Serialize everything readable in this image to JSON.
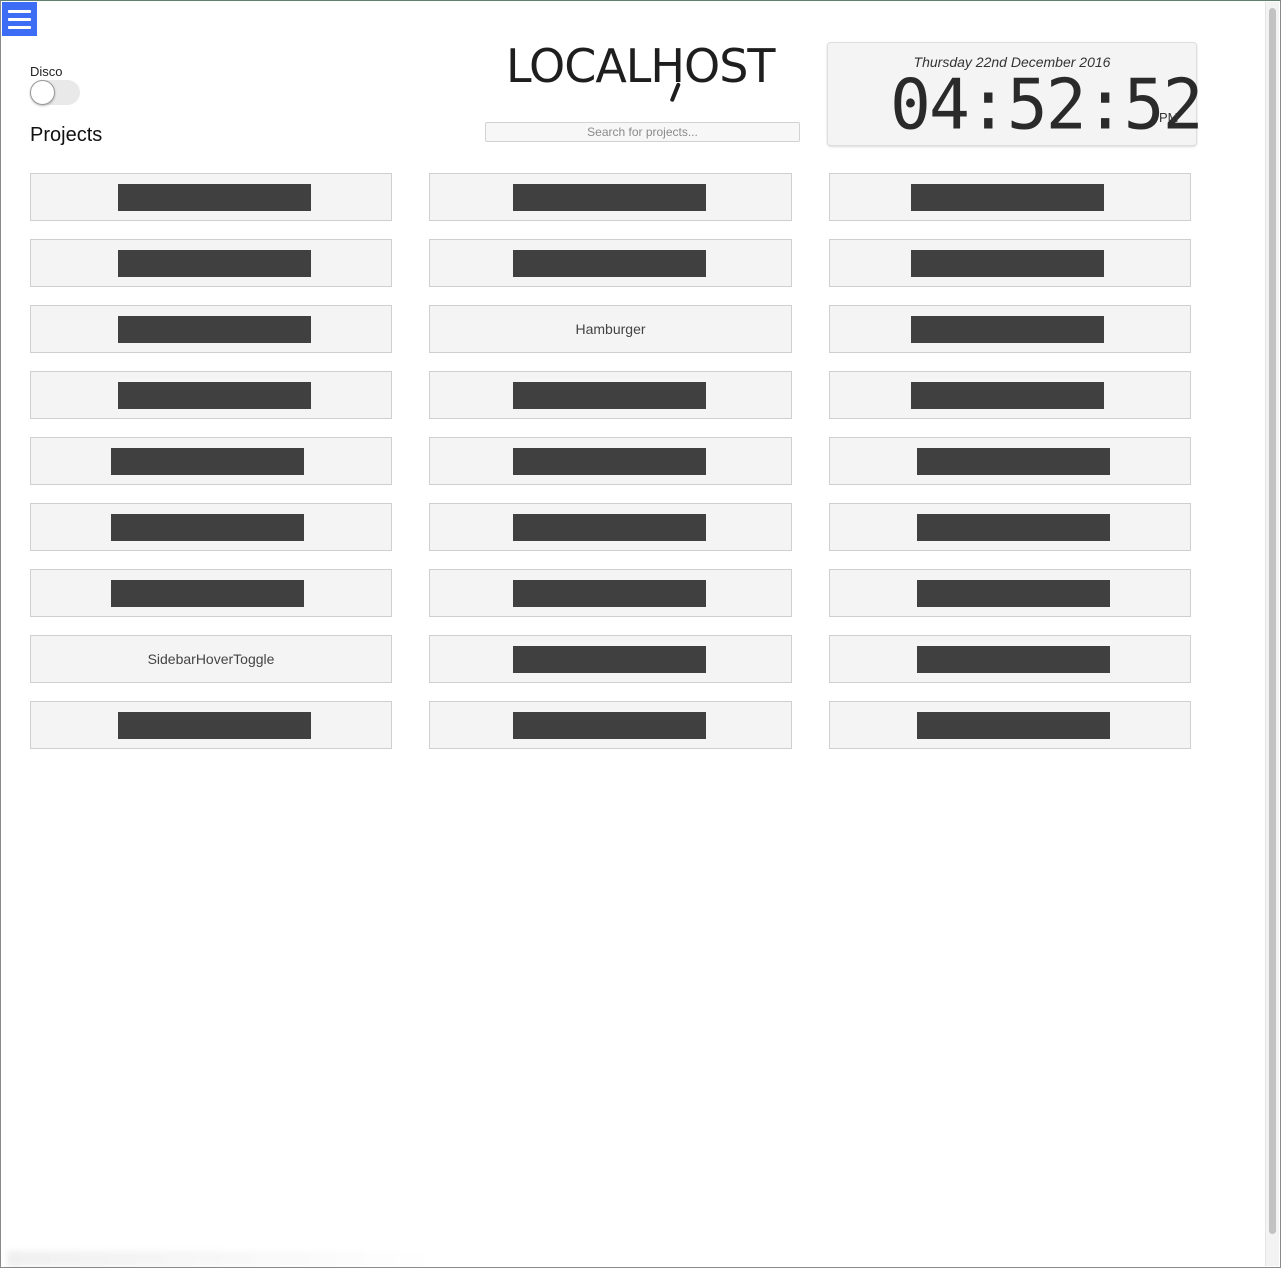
{
  "header": {
    "menu_icon": "hamburger-menu-icon",
    "logo_text": "LOCALHOST",
    "search_placeholder": "Search for projects..."
  },
  "disco": {
    "label": "Disco",
    "enabled": false
  },
  "projects": {
    "heading": "Projects",
    "cards": [
      {
        "label": "",
        "redacted": true
      },
      {
        "label": "",
        "redacted": true
      },
      {
        "label": "",
        "redacted": true
      },
      {
        "label": "",
        "redacted": true
      },
      {
        "label": "",
        "redacted": true
      },
      {
        "label": "",
        "redacted": true
      },
      {
        "label": "",
        "redacted": true
      },
      {
        "label": "Hamburger",
        "redacted": false
      },
      {
        "label": "",
        "redacted": true
      },
      {
        "label": "",
        "redacted": true
      },
      {
        "label": "",
        "redacted": true
      },
      {
        "label": "",
        "redacted": true
      },
      {
        "label": "",
        "redacted": true
      },
      {
        "label": "",
        "redacted": true
      },
      {
        "label": "",
        "redacted": true
      },
      {
        "label": "",
        "redacted": true
      },
      {
        "label": "",
        "redacted": true
      },
      {
        "label": "",
        "redacted": true
      },
      {
        "label": "",
        "redacted": true
      },
      {
        "label": "",
        "redacted": true
      },
      {
        "label": "",
        "redacted": true
      },
      {
        "label": "SidebarHoverToggle",
        "redacted": false
      },
      {
        "label": "",
        "redacted": true
      },
      {
        "label": "",
        "redacted": true
      },
      {
        "label": "",
        "redacted": true
      },
      {
        "label": "",
        "redacted": true
      },
      {
        "label": "",
        "redacted": true
      }
    ]
  },
  "clock": {
    "date": "Thursday 22nd December 2016",
    "time": "04:52:52",
    "ampm": "PM"
  },
  "colors": {
    "accent": "#3d6cf5",
    "card_background": "#f4f4f4",
    "redaction": "#404040"
  }
}
